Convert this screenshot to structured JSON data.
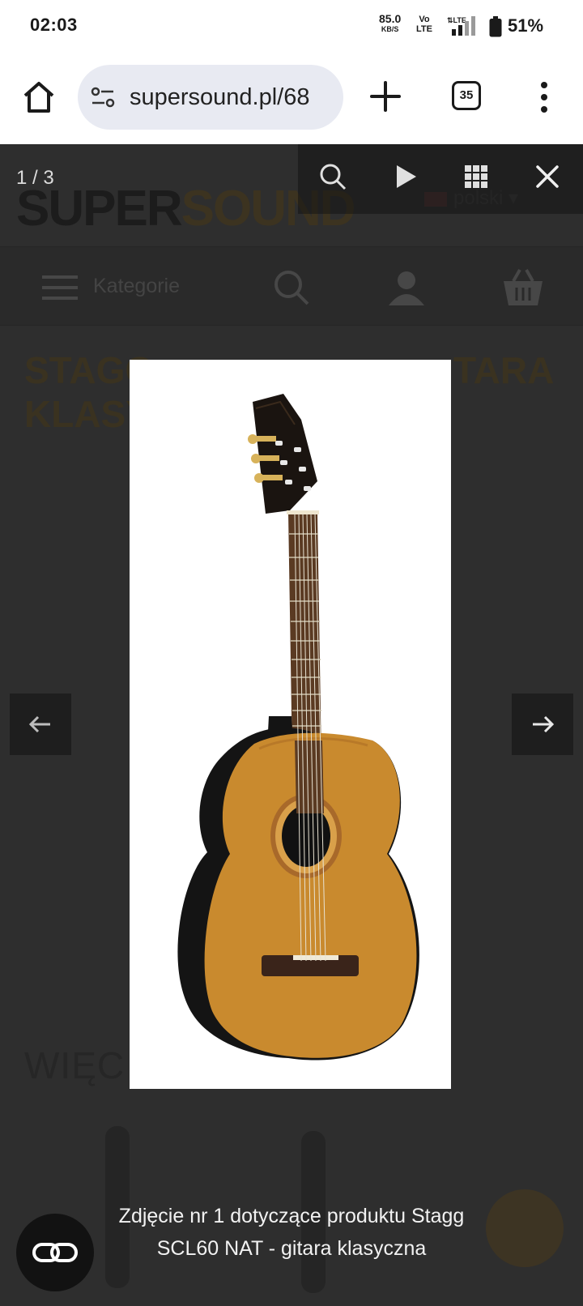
{
  "status_bar": {
    "time": "02:03",
    "net_speed": "85.0",
    "net_speed_unit": "KB/S",
    "volte_line1": "Vo",
    "volte_line2": "LTE",
    "battery_percent": "51%"
  },
  "browser": {
    "url": "supersound.pl/68",
    "tab_count": "35"
  },
  "website": {
    "logo_super": "SUPER",
    "logo_sound": "SOUND",
    "language": "polski",
    "nav_categories": "Kategorie",
    "product_title": "STAGG\nKLASY",
    "product_title_right": "TARA",
    "more_heading": "WIĘC"
  },
  "lightbox": {
    "counter": "1 / 3",
    "caption": "Zdjęcie nr 1 dotyczące produktu Stagg SCL60 NAT - gitara klasyczna",
    "icons": [
      "search-icon",
      "play-icon",
      "grid-icon",
      "close-icon"
    ]
  },
  "colors": {
    "overlay": "#2c2c2c",
    "guitar_top": "#c98a2e",
    "guitar_body_side": "#141414",
    "neck": "#5a3a22",
    "url_pill": "#e8eaf2"
  }
}
